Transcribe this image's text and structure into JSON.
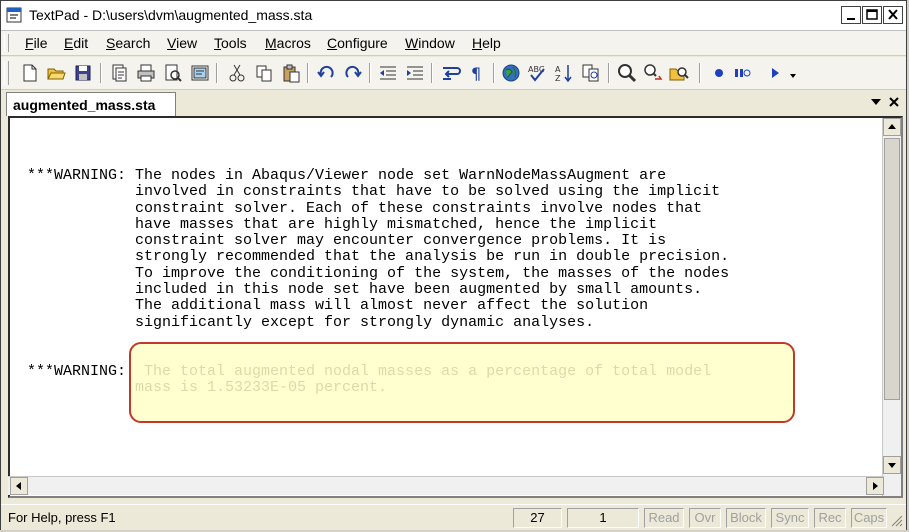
{
  "window": {
    "title": "TextPad - D:\\users\\dvm\\augmented_mass.sta"
  },
  "menu": [
    {
      "mnemonic": "F",
      "rest": "ile"
    },
    {
      "mnemonic": "E",
      "rest": "dit"
    },
    {
      "mnemonic": "S",
      "rest": "earch"
    },
    {
      "mnemonic": "V",
      "rest": "iew"
    },
    {
      "mnemonic": "T",
      "rest": "ools"
    },
    {
      "mnemonic": "M",
      "rest": "acros"
    },
    {
      "mnemonic": "C",
      "rest": "onfigure"
    },
    {
      "mnemonic": "W",
      "rest": "indow"
    },
    {
      "mnemonic": "H",
      "rest": "elp"
    }
  ],
  "tab": {
    "label": "augmented_mass.sta"
  },
  "document": {
    "text": "***WARNING: The nodes in Abaqus/Viewer node set WarnNodeMassAugment are\n            involved in constraints that have to be solved using the implicit\n            constraint solver. Each of these constraints involve nodes that\n            have masses that are highly mismatched, hence the implicit\n            constraint solver may encounter convergence problems. It is\n            strongly recommended that the analysis be run in double precision.\n            To improve the conditioning of the system, the masses of the nodes\n            included in this node set have been augmented by small amounts.\n            The additional mass will almost never affect the solution\n            significantly except for strongly dynamic analyses.\n\n\n***WARNING:  The total augmented nodal masses as a percentage of total model\n            mass is 1.53233E-05 percent."
  },
  "status": {
    "help": "For Help, press F1",
    "line": "27",
    "column": "1",
    "read": "Read",
    "ovr": "Ovr",
    "block": "Block",
    "sync": "Sync",
    "rec": "Rec",
    "caps": "Caps"
  }
}
